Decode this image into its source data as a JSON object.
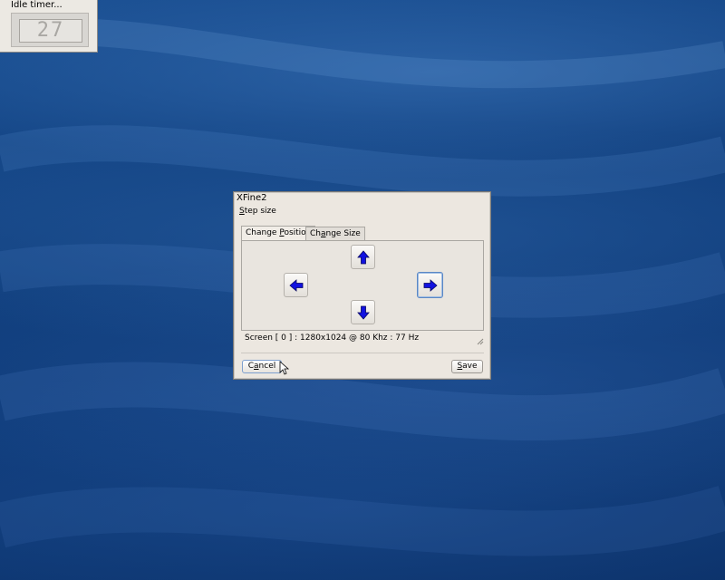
{
  "idle_timer": {
    "title": "Idle timer...",
    "value": "27"
  },
  "dialog": {
    "title": "XFine2",
    "step_size": {
      "prefix": "S",
      "rest": "tep size"
    },
    "tabs": [
      {
        "label_pre": "Change ",
        "label_u": "P",
        "label_post": "osition",
        "active": true
      },
      {
        "label_pre": "Ch",
        "label_u": "a",
        "label_post": "nge Size",
        "active": false
      }
    ],
    "arrows": [
      "arrow-up-icon",
      "arrow-left-icon",
      "arrow-right-icon",
      "arrow-down-icon"
    ],
    "status": "Screen [ 0 ] : 1280x1024 @ 80 Khz : 77 Hz",
    "buttons": {
      "cancel": {
        "pre": "C",
        "u": "a",
        "post": "ncel"
      },
      "save": {
        "pre": "",
        "u": "S",
        "post": "ave"
      }
    }
  },
  "colors": {
    "desktop": "#0f3f82",
    "arrow": "#1212e0",
    "window": "#ece7e0"
  }
}
